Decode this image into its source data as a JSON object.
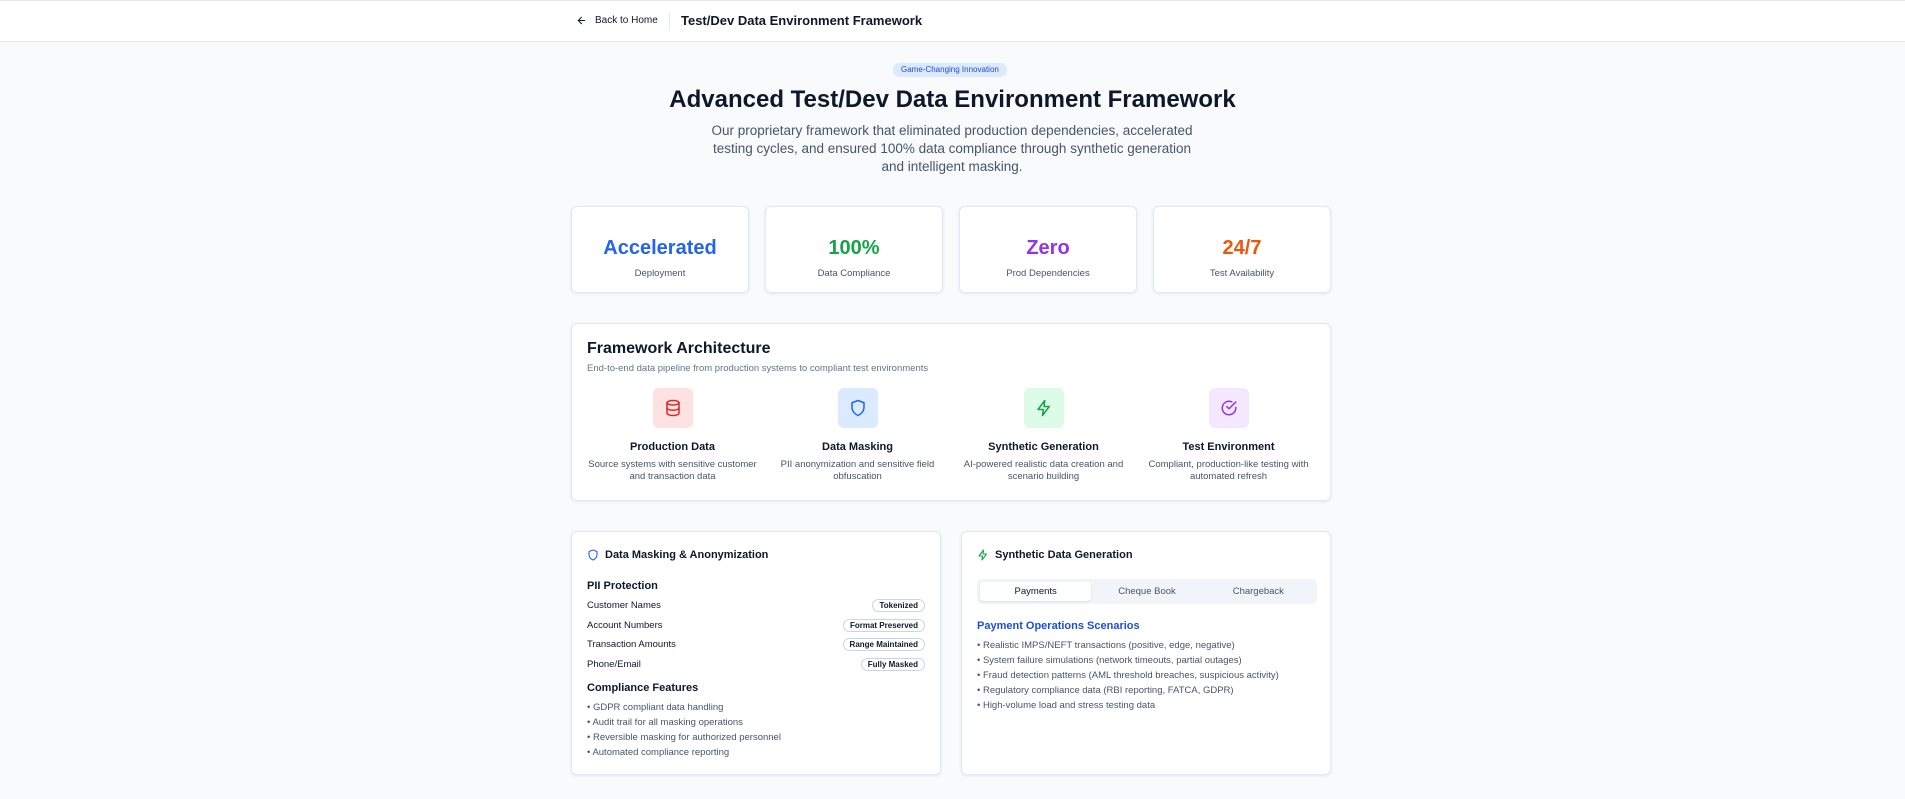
{
  "header": {
    "back_label": "Back to Home",
    "title": "Test/Dev Data Environment Framework"
  },
  "hero": {
    "badge": "Game-Changing Innovation",
    "title": "Advanced Test/Dev Data Environment Framework",
    "subtitle": "Our proprietary framework that eliminated production dependencies, accelerated testing cycles, and ensured 100% data compliance through synthetic generation and intelligent masking."
  },
  "stats": [
    {
      "value": "Accelerated",
      "label": "Deployment",
      "color": "#2563eb"
    },
    {
      "value": "100%",
      "label": "Data Compliance",
      "color": "#16a34a"
    },
    {
      "value": "Zero",
      "label": "Prod Dependencies",
      "color": "#9333ea"
    },
    {
      "value": "24/7",
      "label": "Test Availability",
      "color": "#ea580c"
    }
  ],
  "architecture": {
    "title": "Framework Architecture",
    "subtitle": "End-to-end data pipeline from production systems to compliant test environments",
    "steps": [
      {
        "icon": "database-icon",
        "title": "Production Data",
        "desc": "Source systems with sensitive customer and transaction data",
        "bg": "#fee2e2",
        "fg": "#dc2626"
      },
      {
        "icon": "shield-icon",
        "title": "Data Masking",
        "desc": "PII anonymization and sensitive field obfuscation",
        "bg": "#dbeafe",
        "fg": "#2563eb"
      },
      {
        "icon": "lightning-icon",
        "title": "Synthetic Generation",
        "desc": "AI-powered realistic data creation and scenario building",
        "bg": "#dcfce7",
        "fg": "#16a34a"
      },
      {
        "icon": "check-circle-icon",
        "title": "Test Environment",
        "desc": "Compliant, production-like testing with automated refresh",
        "bg": "#f3e8ff",
        "fg": "#9333ea"
      }
    ]
  },
  "masking": {
    "title": "Data Masking & Anonymization",
    "pii_title": "PII Protection",
    "pii": [
      {
        "field": "Customer Names",
        "method": "Tokenized"
      },
      {
        "field": "Account Numbers",
        "method": "Format Preserved"
      },
      {
        "field": "Transaction Amounts",
        "method": "Range Maintained"
      },
      {
        "field": "Phone/Email",
        "method": "Fully Masked"
      }
    ],
    "compliance_title": "Compliance Features",
    "compliance": [
      "• GDPR compliant data handling",
      "• Audit trail for all masking operations",
      "• Reversible masking for authorized personnel",
      "• Automated compliance reporting"
    ]
  },
  "synthetic": {
    "title": "Synthetic Data Generation",
    "tabs": [
      "Payments",
      "Cheque Book",
      "Chargeback"
    ],
    "active_tab": "Payments",
    "scenario_title": "Payment Operations Scenarios",
    "scenarios": [
      "• Realistic IMPS/NEFT transactions (positive, edge, negative)",
      "• System failure simulations (network timeouts, partial outages)",
      "• Fraud detection patterns (AML threshold breaches, suspicious activity)",
      "• Regulatory compliance data (RBI reporting, FATCA, GDPR)",
      "• High-volume load and stress testing data"
    ]
  }
}
